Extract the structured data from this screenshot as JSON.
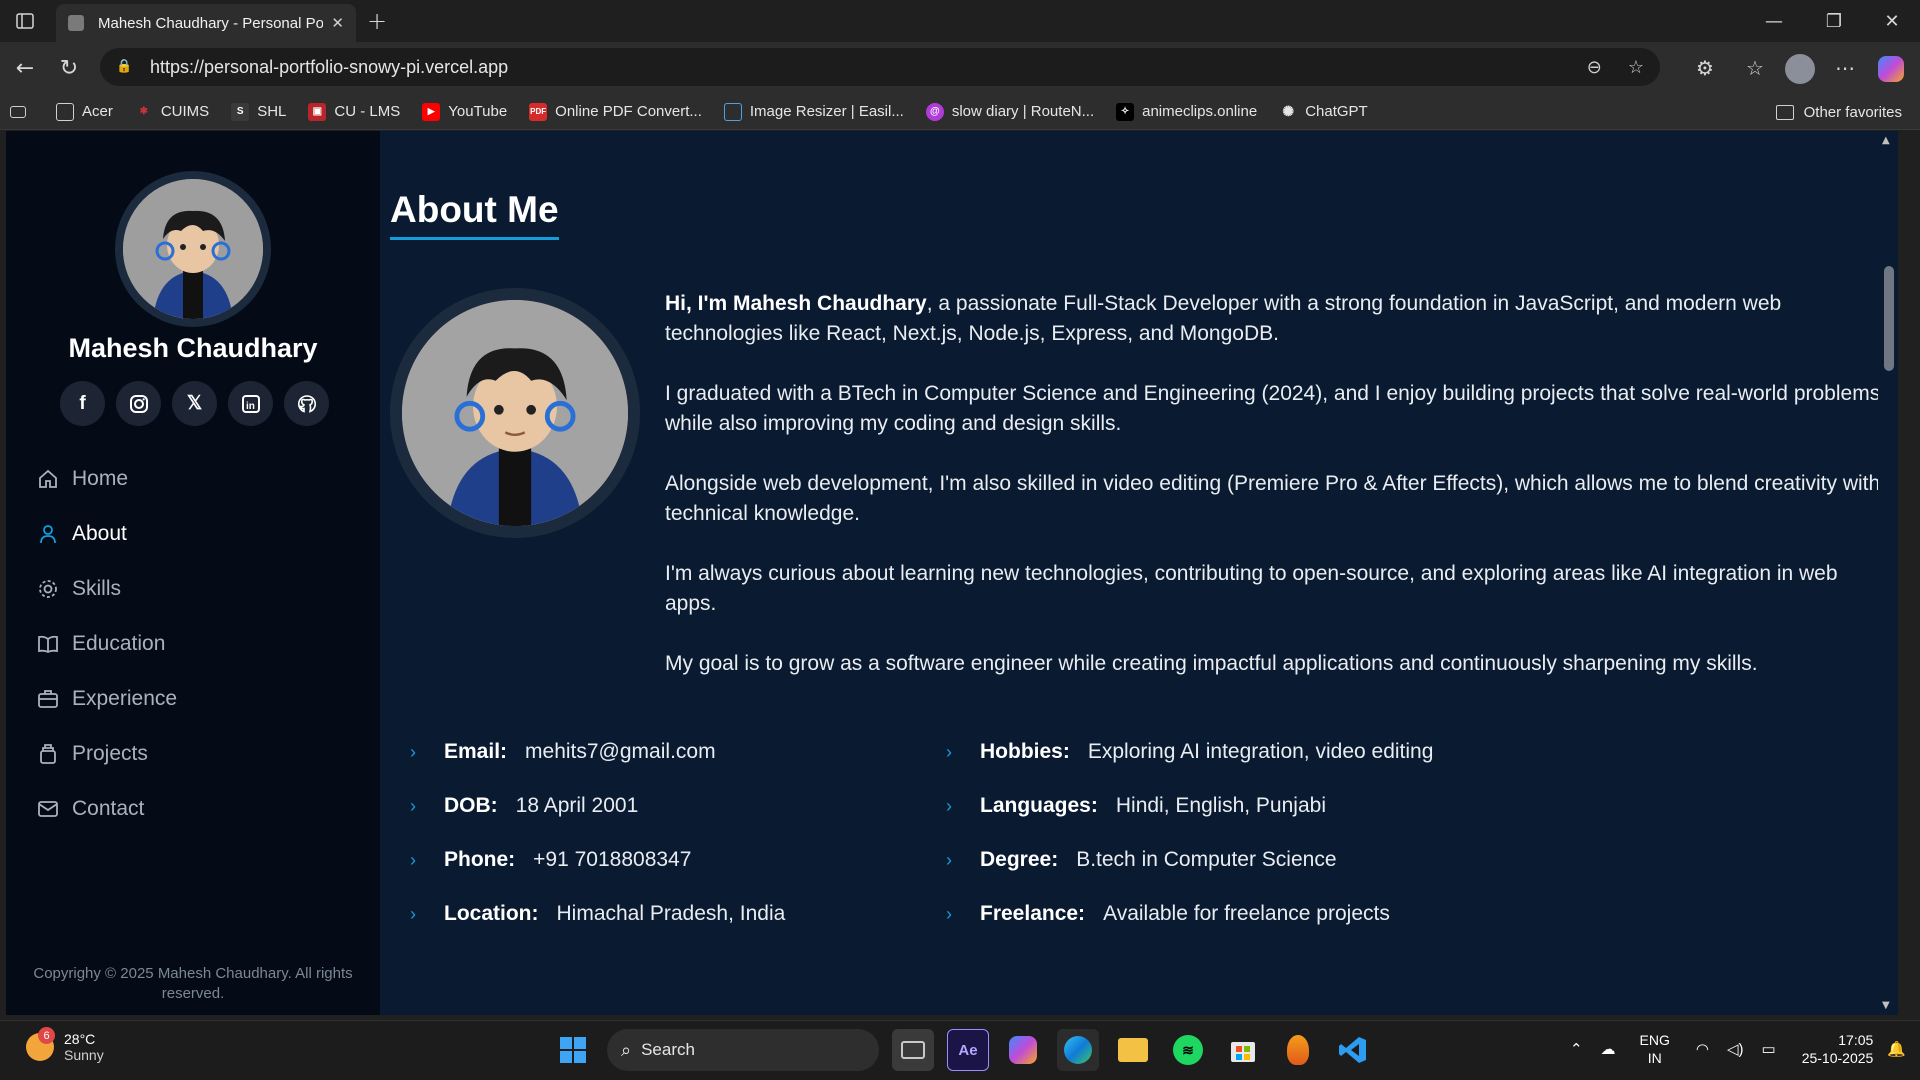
{
  "browser": {
    "tab_title": "Mahesh Chaudhary - Personal Po",
    "url": "https://personal-portfolio-snowy-pi.vercel.app",
    "bookmarks": [
      "Acer",
      "CUIMS",
      "SHL",
      "CU - LMS",
      "YouTube",
      "Online PDF Convert...",
      "Image Resizer | Easil...",
      "slow diary | RouteN...",
      "animeclips.online",
      "ChatGPT"
    ],
    "other_favorites": "Other favorites"
  },
  "sidebar": {
    "name": "Mahesh Chaudhary",
    "socials": [
      "facebook-icon",
      "instagram-icon",
      "x-icon",
      "linkedin-icon",
      "github-icon"
    ],
    "nav": [
      {
        "label": "Home",
        "icon": "home-icon",
        "active": false
      },
      {
        "label": "About",
        "icon": "user-icon",
        "active": true
      },
      {
        "label": "Skills",
        "icon": "gear-icon",
        "active": false
      },
      {
        "label": "Education",
        "icon": "book-icon",
        "active": false
      },
      {
        "label": "Experience",
        "icon": "briefcase-icon",
        "active": false
      },
      {
        "label": "Projects",
        "icon": "projects-icon",
        "active": false
      },
      {
        "label": "Contact",
        "icon": "mail-icon",
        "active": false
      }
    ],
    "copyright": "Copyrighy © 2025 Mahesh Chaudhary. All rights reserved."
  },
  "about": {
    "title": "About Me",
    "intro_bold": "Hi, I'm Mahesh Chaudhary",
    "intro_rest": ", a passionate Full-Stack Developer with a strong foundation in JavaScript, and modern web technologies like React, Next.js, Node.js, Express, and MongoDB.",
    "paragraphs": [
      "I graduated with a BTech in Computer Science and Engineering (2024), and I enjoy building projects that solve real-world problems while also improving my coding and design skills.",
      "Alongside web development, I'm also skilled in video editing (Premiere Pro & After Effects), which allows me to blend creativity with technical knowledge.",
      "I'm always curious about learning new technologies, contributing to open-source, and exploring areas like AI integration in web apps.",
      "My goal is to grow as a software engineer while creating impactful applications and continuously sharpening my skills."
    ],
    "info_left": [
      {
        "label": "Email:",
        "value": "mehits7@gmail.com"
      },
      {
        "label": "DOB:",
        "value": "18 April 2001"
      },
      {
        "label": "Phone:",
        "value": "+91 7018808347"
      },
      {
        "label": "Location:",
        "value": "Himachal Pradesh, India"
      }
    ],
    "info_right": [
      {
        "label": "Hobbies:",
        "value": "Exploring AI integration, video editing"
      },
      {
        "label": "Languages:",
        "value": "Hindi, English, Punjabi"
      },
      {
        "label": "Degree:",
        "value": "B.tech in Computer Science"
      },
      {
        "label": "Freelance:",
        "value": "Available for freelance projects"
      }
    ]
  },
  "taskbar": {
    "weather_temp": "28°C",
    "weather_desc": "Sunny",
    "weather_badge": "6",
    "search_placeholder": "Search",
    "lang_1": "ENG",
    "lang_2": "IN",
    "time": "17:05",
    "date": "25-10-2025"
  },
  "colors": {
    "accent": "#149ddd",
    "page_bg": "#0a1a30",
    "sidebar_bg": "#040b17"
  }
}
